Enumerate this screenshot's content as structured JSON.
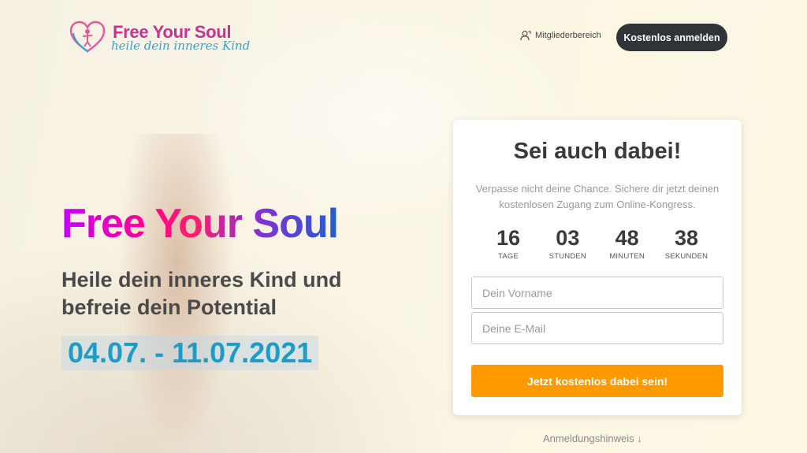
{
  "header": {
    "logo_title": "Free Your Soul",
    "logo_tagline": "heile dein inneres Kind",
    "member_link": "Mitgliederbereich",
    "register_button": "Kostenlos anmelden"
  },
  "hero": {
    "title": "Free Your Soul",
    "subtitle": "Heile dein inneres Kind und befreie dein Potential",
    "dates": "04.07. - 11.07.2021"
  },
  "signup": {
    "title": "Sei auch dabei!",
    "text": "Verpasse nicht deine Chance. Sichere dir jetzt deinen kostenlosen Zugang zum Online-Kongress.",
    "countdown": [
      {
        "value": "16",
        "label": "TAGE"
      },
      {
        "value": "03",
        "label": "STUNDEN"
      },
      {
        "value": "48",
        "label": "MINUTEN"
      },
      {
        "value": "38",
        "label": "SEKUNDEN"
      }
    ],
    "firstname_placeholder": "Dein Vorname",
    "email_placeholder": "Deine E-Mail",
    "submit_button": "Jetzt kostenlos dabei sein!",
    "hint_link": "Anmeldungshinweis ↓"
  },
  "icons": {
    "logo": "heart-logo-icon",
    "member": "member-user-icon"
  },
  "colors": {
    "accent": "#ff9900",
    "dark_button": "#2f3438",
    "date_blue": "#1e9bc6",
    "logo_pink": "#c2358f",
    "logo_blue": "#3aa3c9"
  }
}
